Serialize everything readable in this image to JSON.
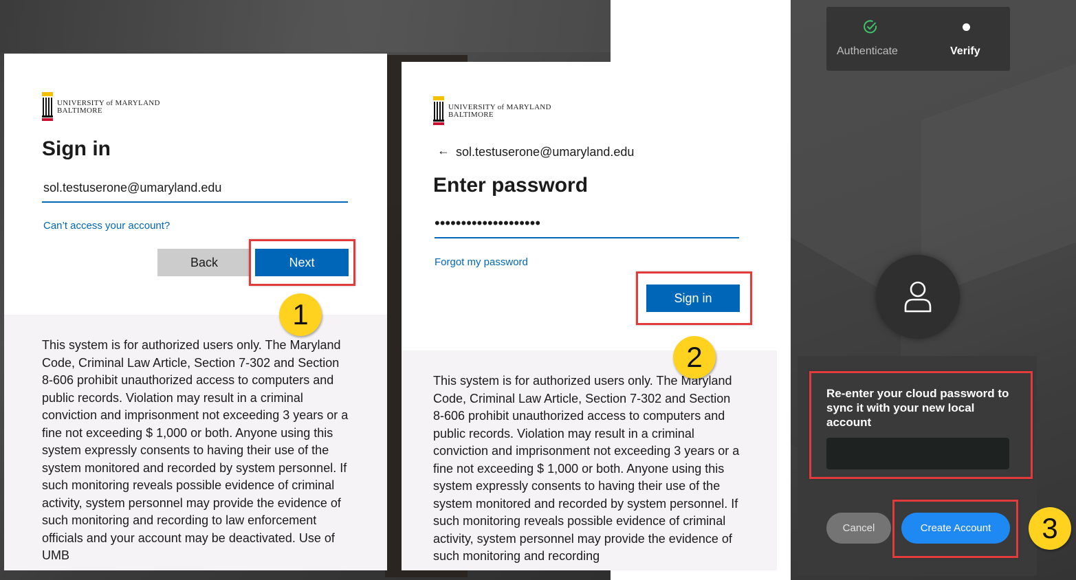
{
  "panel1": {
    "logo_line1": "UNIVERSITY of MARYLAND",
    "logo_line2": "BALTIMORE",
    "title": "Sign in",
    "email_value": "sol.testuserone@umaryland.edu",
    "cant_access_link": "Can’t access your account?",
    "back_label": "Back",
    "next_label": "Next",
    "notice": "This system is for authorized users only. The Maryland Code, Criminal Law Article, Section 7-302 and Section 8-606 prohibit unauthorized access to computers and public records. Violation may result in a criminal conviction and imprisonment not exceeding 3 years or a fine not exceeding $ 1,000 or both. Anyone using this system expressly consents to having their use of the system monitored and recorded by system personnel. If such monitoring reveals possible evidence of criminal activity, system personnel may provide the evidence of such monitoring and recording to law enforcement officials and your account may be deactivated. Use of UMB"
  },
  "panel2": {
    "logo_line1": "UNIVERSITY of MARYLAND",
    "logo_line2": "BALTIMORE",
    "back_arrow": "←",
    "email": "sol.testuserone@umaryland.edu",
    "title": "Enter password",
    "password_mask": "••••••••••••••••••••",
    "forgot_link": "Forgot my password",
    "signin_label": "Sign in",
    "notice": "This system is for authorized users only. The Maryland Code, Criminal Law Article, Section 7-302 and Section 8-606 prohibit unauthorized access to computers and public records. Violation may result in a criminal conviction and imprisonment not exceeding 3 years or a fine not exceeding $ 1,000 or both. Anyone using this system expressly consents to having their use of the system monitored and recorded by system personnel. If such monitoring reveals possible evidence of criminal activity, system personnel may provide the evidence of such monitoring and recording"
  },
  "panel3": {
    "steps": [
      {
        "label": "Authenticate",
        "icon": "check-circle-icon",
        "state": "done"
      },
      {
        "label": "Verify",
        "icon": "dot-icon",
        "state": "active"
      }
    ],
    "prompt": "Re-enter your cloud password to sync it with your new local account",
    "password_value": "",
    "cancel_label": "Cancel",
    "create_label": "Create Account"
  },
  "callouts": {
    "one": "1",
    "two": "2",
    "three": "3"
  },
  "colors": {
    "ms_blue": "#0067b8",
    "highlight_red": "#e23b3b",
    "badge_yellow": "#ffd21f",
    "create_blue": "#1e88f3",
    "check_green": "#3cc46a"
  }
}
